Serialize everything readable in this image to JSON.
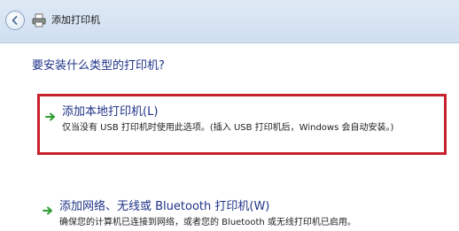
{
  "window": {
    "title": "添加打印机"
  },
  "main": {
    "question": "要安装什么类型的打印机?",
    "options": [
      {
        "title": "添加本地打印机(L)",
        "description": "仅当没有 USB 打印机时使用此选项。(插入 USB 打印机后，Windows 会自动安装。)"
      },
      {
        "title": "添加网络、无线或 Bluetooth 打印机(W)",
        "description": "确保您的计算机已连接到网络，或者您的 Bluetooth 或无线打印机已启用。"
      }
    ]
  },
  "colors": {
    "accent_text": "#1e3287",
    "highlight_border": "#c8212e",
    "arrow_green": "#2e9b2e"
  },
  "icons": {
    "back": "back-arrow-icon",
    "printer": "printer-icon",
    "option_arrow": "green-arrow-icon"
  }
}
